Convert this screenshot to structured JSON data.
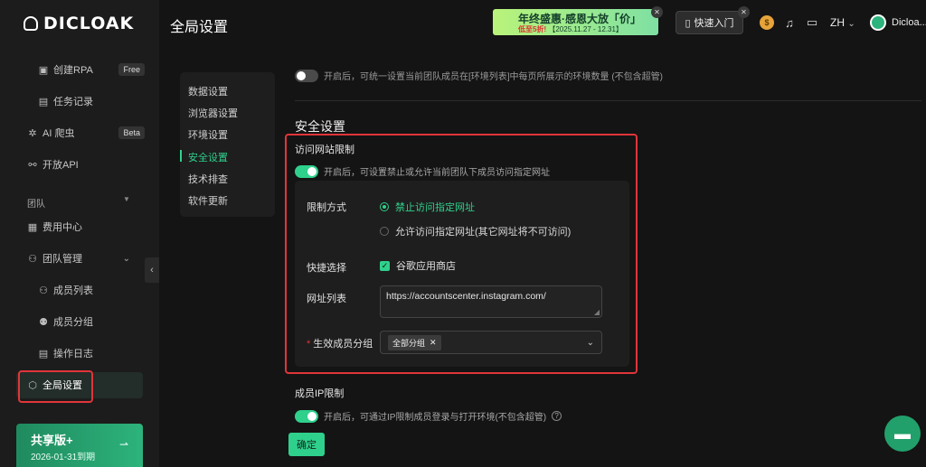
{
  "brand": {
    "name": "DICLOAK"
  },
  "page_title": "全局设置",
  "promo": {
    "title": "年终盛惠·感恩大放「价」",
    "sub_red": "低至5折!",
    "sub_date": "【2025.11.27 - 12.31】"
  },
  "topbar": {
    "quick_start": "快速入门",
    "lang": "ZH",
    "user": "Dicloa..."
  },
  "sidebar": {
    "items": [
      {
        "label": "创建RPA",
        "badge": "Free",
        "icon": "rpa-icon"
      },
      {
        "label": "任务记录",
        "icon": "task-record-icon"
      },
      {
        "label": "AI 爬虫",
        "badge": "Beta",
        "icon": "ai-crawler-icon"
      },
      {
        "label": "开放API",
        "icon": "api-icon"
      }
    ],
    "section": "团队",
    "team_items": [
      {
        "label": "费用中心",
        "icon": "billing-icon"
      },
      {
        "label": "团队管理",
        "icon": "team-icon"
      },
      {
        "label": "成员列表",
        "icon": "members-icon"
      },
      {
        "label": "成员分组",
        "icon": "member-group-icon"
      },
      {
        "label": "操作日志",
        "icon": "log-icon"
      },
      {
        "label": "全局设置",
        "icon": "settings-hexagon-icon"
      }
    ],
    "plan": {
      "name": "共享版+",
      "expiry": "2026-01-31到期"
    }
  },
  "settings_nav": [
    "数据设置",
    "浏览器设置",
    "环境设置",
    "安全设置",
    "技术排查",
    "软件更新"
  ],
  "main": {
    "top_partial": "开启后，可统一设置当前团队成员在[环境列表]中每页所展示的环境数量 (不包含超管)",
    "section_title": "安全设置",
    "site_limit": {
      "title": "访问网站限制",
      "toggle_desc": "开启后，可设置禁止或允许当前团队下成员访问指定网址",
      "method_label": "限制方式",
      "option_deny": "禁止访问指定网址",
      "option_allow": "允许访问指定网址(其它网址将不可访问)",
      "quick_label": "快捷选择",
      "quick_option": "谷歌应用商店",
      "url_label": "网址列表",
      "url_value": "https://accountscenter.instagram.com/",
      "group_label": "生效成员分组",
      "group_tag": "全部分组"
    },
    "ip_limit": {
      "title": "成员IP限制",
      "toggle_desc": "开启后，可通过IP限制成员登录与打开环境(不包含超管)"
    },
    "confirm": "确定"
  },
  "colors": {
    "accent": "#2fd08c",
    "highlight": "#e0353a",
    "background": "#141414"
  }
}
